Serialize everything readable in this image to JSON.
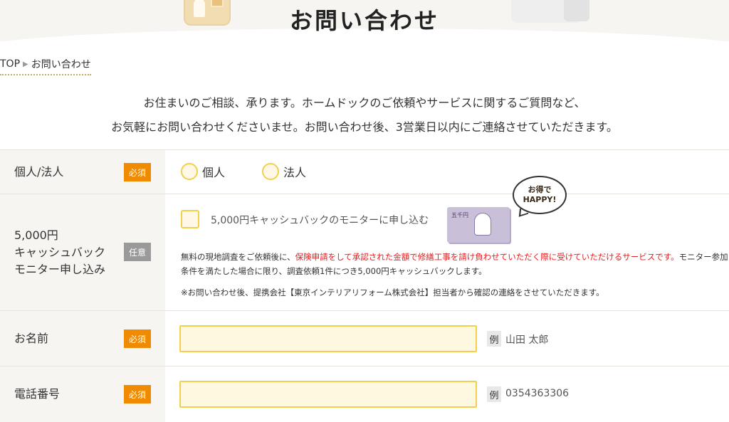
{
  "hero": {
    "title": "お問い合わせ"
  },
  "breadcrumb": {
    "home": "TOP",
    "arrow": "▶",
    "current": "お問い合わせ"
  },
  "intro": {
    "line1": "お住まいのご相談、承ります。ホームドックのご依頼やサービスに関するご質問など、",
    "line2": "お気軽にお問い合わせくださいませ。お問い合わせ後、3営業日以内にご連絡させていただきます。"
  },
  "colors": {
    "accent": "#f08a00",
    "field_border": "#f3d04b",
    "field_bg": "#fff8e0",
    "label_bg": "#f7f5f2",
    "highlight_red": "#e02020"
  },
  "form": {
    "customer_type": {
      "label": "個人/法人",
      "badge": "必須",
      "options": [
        "個人",
        "法人"
      ]
    },
    "cashback": {
      "label_line1": "5,000円",
      "label_line2": "キャッシュバック",
      "label_line3": "モニター申し込み",
      "badge": "任意",
      "checkbox_label": "5,000円キャッシュバックのモニターに申し込む",
      "bubble_line1": "お得で",
      "bubble_line2": "HAPPY!",
      "bill_text": "五千円",
      "note_pre": "無料の現地調査をご依頼後に、",
      "note_red": "保険申請をして承認された金額で修繕工事を請け負わせていただく際に受けていただけるサービスです。",
      "note_post": "モニター参加条件を満たした場合に限り、調査依頼1件につき5,000円キャッシュバックします。",
      "note2": "※お問い合わせ後、提携会社【東京インテリアリフォーム株式会社】担当者から確認の連絡をさせていただきます。"
    },
    "name": {
      "label": "お名前",
      "badge": "必須",
      "value": "",
      "example_tag": "例",
      "example": "山田 太郎"
    },
    "phone": {
      "label": "電話番号",
      "badge": "必須",
      "value": "",
      "example_tag": "例",
      "example": "0354363306"
    }
  }
}
